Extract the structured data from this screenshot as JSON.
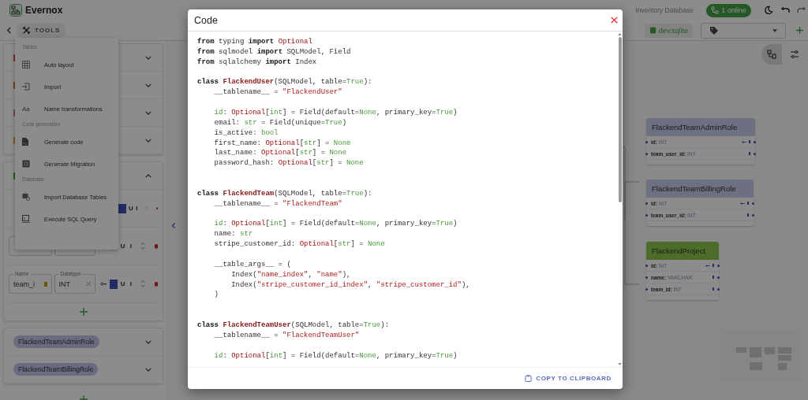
{
  "app": {
    "name": "Evernox",
    "tools_label": "TOOLS",
    "project": "Inventory Database",
    "online": "1 online",
    "database": "dev.sqlite"
  },
  "tools_menu": [
    {
      "title": "Tables",
      "items": [
        {
          "label": "Auto layout",
          "kind": "grid"
        },
        {
          "label": "Import",
          "kind": "import"
        },
        {
          "label": "Name transformations",
          "kind": "text",
          "icon_text": "Aa"
        }
      ]
    },
    {
      "title": "Code generation",
      "items": [
        {
          "label": "Generate code",
          "kind": "file"
        },
        {
          "label": "Generate Migration",
          "kind": "box"
        }
      ]
    },
    {
      "title": "Database",
      "items": [
        {
          "label": "Import Database Tables",
          "kind": "database"
        },
        {
          "label": "Execute SQL Query",
          "kind": "terminal"
        }
      ]
    }
  ],
  "sidebar": {
    "collapsed_tables": [
      {
        "color": "#7b2727"
      },
      {
        "color": "#7b3a1a"
      },
      {
        "color": "#6a4a42"
      },
      {
        "color": "#7b5a12"
      }
    ],
    "expanded_table": {
      "color": "#255a27",
      "fields": [
        {
          "kind": "toggles",
          "key_on": true,
          "flags": [
            "U",
            "I"
          ]
        },
        {
          "kind": "full",
          "flags": [
            "U",
            "I"
          ]
        },
        {
          "kind": "full",
          "name_label": "Name",
          "type_label": "Datatype",
          "name": "team_i",
          "type": "INT",
          "key_on": true,
          "flags": [
            "U",
            "I"
          ]
        }
      ]
    },
    "named_tables": [
      {
        "name": "FlackendTeamAdminRole",
        "color": "#6a6c80"
      },
      {
        "name": "FlackendTeamBillingRole",
        "color": "#6a6c80"
      }
    ]
  },
  "canvas_tables": [
    {
      "name": "FlackendTeamAdminRole",
      "color": "#6d7080",
      "fields": [
        {
          "name": "id:",
          "type": "INT",
          "primary": true
        },
        {
          "name": "team_user_id:",
          "type": "INT",
          "primary": false
        }
      ]
    },
    {
      "name": "FlackendTeamBillingRole",
      "color": "#6d7080",
      "fields": [
        {
          "name": "id:",
          "type": "INT",
          "primary": true
        },
        {
          "name": "team_user_id:",
          "type": "INT",
          "primary": false
        }
      ]
    },
    {
      "name": "FlackendProject",
      "color": "#4d6b2a",
      "fields": [
        {
          "name": "id:",
          "type": "INT",
          "primary": true
        },
        {
          "name": "name:",
          "type": "VARCHAR",
          "primary": false
        },
        {
          "name": "team_id:",
          "type": "INT",
          "primary": false
        }
      ]
    }
  ],
  "code_dialog": {
    "title": "Code",
    "copy_label": "COPY TO CLIPBOARD",
    "lines": [
      {
        "kind": "code",
        "tokens": [
          {
            "text": "from",
            "kind": "kw"
          },
          {
            "text": " typing ",
            "kind": "plain"
          },
          {
            "text": "import ",
            "kind": "kw"
          },
          {
            "text": "Optional",
            "kind": "type"
          }
        ]
      },
      {
        "kind": "code",
        "tokens": [
          {
            "text": "from",
            "kind": "kw"
          },
          {
            "text": " sqlmodel ",
            "kind": "plain"
          },
          {
            "text": "import",
            "kind": "kw"
          },
          {
            "text": " SQLModel, Field",
            "kind": "plain"
          }
        ]
      },
      {
        "kind": "code",
        "tokens": [
          {
            "text": "from",
            "kind": "kw"
          },
          {
            "text": " sqlalchemy ",
            "kind": "plain"
          },
          {
            "text": "import",
            "kind": "kw"
          },
          {
            "text": " Index",
            "kind": "plain"
          }
        ]
      },
      {
        "kind": "blank"
      },
      {
        "kind": "code",
        "tokens": [
          {
            "text": "class ",
            "kind": "kw"
          },
          {
            "text": "FlackendUser",
            "kind": "cls"
          },
          {
            "text": "(SQLModel, table=",
            "kind": "plain"
          },
          {
            "text": "True",
            "kind": "builtin"
          },
          {
            "text": "):",
            "kind": "plain"
          }
        ]
      },
      {
        "kind": "code",
        "tokens": [
          {
            "text": "    __tablename__ = ",
            "kind": "plain"
          },
          {
            "text": "\"FlackendUser\"",
            "kind": "str"
          }
        ]
      },
      {
        "kind": "blank"
      },
      {
        "kind": "code",
        "tokens": [
          {
            "text": "    id",
            "kind": "builtin"
          },
          {
            "text": ": ",
            "kind": "plain"
          },
          {
            "text": "Optional",
            "kind": "type"
          },
          {
            "text": "[",
            "kind": "plain"
          },
          {
            "text": "int",
            "kind": "builtin"
          },
          {
            "text": "] = Field(default=",
            "kind": "plain"
          },
          {
            "text": "None",
            "kind": "builtin"
          },
          {
            "text": ", primary_key=",
            "kind": "plain"
          },
          {
            "text": "True",
            "kind": "builtin"
          },
          {
            "text": ")",
            "kind": "plain"
          }
        ]
      },
      {
        "kind": "code",
        "tokens": [
          {
            "text": "    email: ",
            "kind": "plain"
          },
          {
            "text": "str",
            "kind": "builtin"
          },
          {
            "text": " = Field(unique=",
            "kind": "plain"
          },
          {
            "text": "True",
            "kind": "builtin"
          },
          {
            "text": ")",
            "kind": "plain"
          }
        ]
      },
      {
        "kind": "code",
        "tokens": [
          {
            "text": "    is_active: ",
            "kind": "plain"
          },
          {
            "text": "bool",
            "kind": "builtin"
          }
        ]
      },
      {
        "kind": "code",
        "tokens": [
          {
            "text": "    first_name: ",
            "kind": "plain"
          },
          {
            "text": "Optional",
            "kind": "type"
          },
          {
            "text": "[",
            "kind": "plain"
          },
          {
            "text": "str",
            "kind": "builtin"
          },
          {
            "text": "] = ",
            "kind": "plain"
          },
          {
            "text": "None",
            "kind": "builtin"
          }
        ]
      },
      {
        "kind": "code",
        "tokens": [
          {
            "text": "    last_name: ",
            "kind": "plain"
          },
          {
            "text": "Optional",
            "kind": "type"
          },
          {
            "text": "[",
            "kind": "plain"
          },
          {
            "text": "str",
            "kind": "builtin"
          },
          {
            "text": "] = ",
            "kind": "plain"
          },
          {
            "text": "None",
            "kind": "builtin"
          }
        ]
      },
      {
        "kind": "code",
        "tokens": [
          {
            "text": "    password_hash: ",
            "kind": "plain"
          },
          {
            "text": "Optional",
            "kind": "type"
          },
          {
            "text": "[",
            "kind": "plain"
          },
          {
            "text": "str",
            "kind": "builtin"
          },
          {
            "text": "] = ",
            "kind": "plain"
          },
          {
            "text": "None",
            "kind": "builtin"
          }
        ]
      },
      {
        "kind": "blank"
      },
      {
        "kind": "blank"
      },
      {
        "kind": "code",
        "tokens": [
          {
            "text": "class ",
            "kind": "kw"
          },
          {
            "text": "FlackendTeam",
            "kind": "cls"
          },
          {
            "text": "(SQLModel, table=",
            "kind": "plain"
          },
          {
            "text": "True",
            "kind": "builtin"
          },
          {
            "text": "):",
            "kind": "plain"
          }
        ]
      },
      {
        "kind": "code",
        "tokens": [
          {
            "text": "    __tablename__ = ",
            "kind": "plain"
          },
          {
            "text": "\"FlackendTeam\"",
            "kind": "str"
          }
        ]
      },
      {
        "kind": "blank"
      },
      {
        "kind": "code",
        "tokens": [
          {
            "text": "    id",
            "kind": "builtin"
          },
          {
            "text": ": ",
            "kind": "plain"
          },
          {
            "text": "Optional",
            "kind": "type"
          },
          {
            "text": "[",
            "kind": "plain"
          },
          {
            "text": "int",
            "kind": "builtin"
          },
          {
            "text": "] = Field(default=",
            "kind": "plain"
          },
          {
            "text": "None",
            "kind": "builtin"
          },
          {
            "text": ", primary_key=",
            "kind": "plain"
          },
          {
            "text": "True",
            "kind": "builtin"
          },
          {
            "text": ")",
            "kind": "plain"
          }
        ]
      },
      {
        "kind": "code",
        "tokens": [
          {
            "text": "    name: ",
            "kind": "plain"
          },
          {
            "text": "str",
            "kind": "builtin"
          }
        ]
      },
      {
        "kind": "code",
        "tokens": [
          {
            "text": "    stripe_customer_id: ",
            "kind": "plain"
          },
          {
            "text": "Optional",
            "kind": "type"
          },
          {
            "text": "[",
            "kind": "plain"
          },
          {
            "text": "str",
            "kind": "builtin"
          },
          {
            "text": "] = ",
            "kind": "plain"
          },
          {
            "text": "None",
            "kind": "builtin"
          }
        ]
      },
      {
        "kind": "blank"
      },
      {
        "kind": "code",
        "tokens": [
          {
            "text": "    __table_args__ = (",
            "kind": "plain"
          }
        ]
      },
      {
        "kind": "code",
        "tokens": [
          {
            "text": "        Index(",
            "kind": "plain"
          },
          {
            "text": "\"name_index\"",
            "kind": "str"
          },
          {
            "text": ", ",
            "kind": "plain"
          },
          {
            "text": "\"name\"",
            "kind": "str"
          },
          {
            "text": "),",
            "kind": "plain"
          }
        ]
      },
      {
        "kind": "code",
        "tokens": [
          {
            "text": "        Index(",
            "kind": "plain"
          },
          {
            "text": "\"stripe_customer_id_index\"",
            "kind": "str"
          },
          {
            "text": ", ",
            "kind": "plain"
          },
          {
            "text": "\"stripe_customer_id\"",
            "kind": "str"
          },
          {
            "text": "),",
            "kind": "plain"
          }
        ]
      },
      {
        "kind": "code",
        "tokens": [
          {
            "text": "    )",
            "kind": "plain"
          }
        ]
      },
      {
        "kind": "blank"
      },
      {
        "kind": "blank"
      },
      {
        "kind": "code",
        "tokens": [
          {
            "text": "class ",
            "kind": "kw"
          },
          {
            "text": "FlackendTeamUser",
            "kind": "cls"
          },
          {
            "text": "(SQLModel, table=",
            "kind": "plain"
          },
          {
            "text": "True",
            "kind": "builtin"
          },
          {
            "text": "):",
            "kind": "plain"
          }
        ]
      },
      {
        "kind": "code",
        "tokens": [
          {
            "text": "    __tablename__ = ",
            "kind": "plain"
          },
          {
            "text": "\"FlackendTeamUser\"",
            "kind": "str"
          }
        ]
      },
      {
        "kind": "blank"
      },
      {
        "kind": "code",
        "tokens": [
          {
            "text": "    id",
            "kind": "builtin"
          },
          {
            "text": ": ",
            "kind": "plain"
          },
          {
            "text": "Optional",
            "kind": "type"
          },
          {
            "text": "[",
            "kind": "plain"
          },
          {
            "text": "int",
            "kind": "builtin"
          },
          {
            "text": "] = Field(default=",
            "kind": "plain"
          },
          {
            "text": "None",
            "kind": "builtin"
          },
          {
            "text": ", primary_key=",
            "kind": "plain"
          },
          {
            "text": "True",
            "kind": "builtin"
          },
          {
            "text": ")",
            "kind": "plain"
          }
        ]
      }
    ]
  }
}
